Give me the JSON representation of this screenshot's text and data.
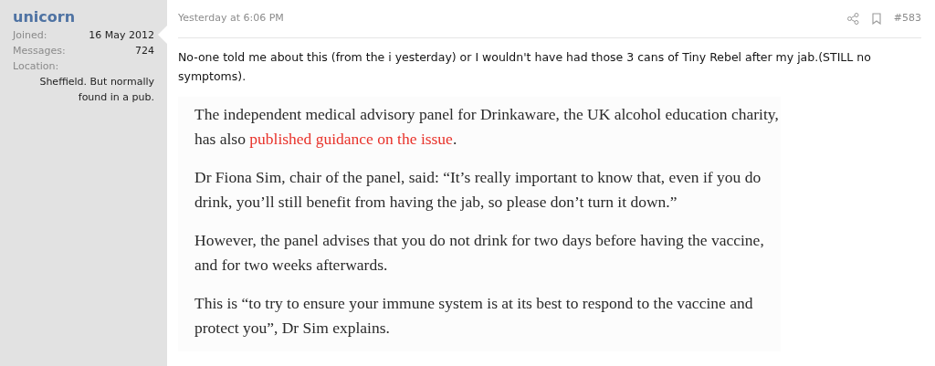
{
  "author": {
    "name": "unicorn",
    "stats": [
      {
        "label": "Joined:",
        "value": "16 May 2012"
      },
      {
        "label": "Messages:",
        "value": "724"
      }
    ],
    "location_label": "Location:",
    "location": "Sheffield. But normally found in a pub."
  },
  "post": {
    "time": "Yesterday at 6:06 PM",
    "number": "#583",
    "body": "No-one told me about this (from the i yesterday) or I wouldn't have had those 3 cans of Tiny Rebel after my jab.(STILL no symptoms).",
    "quote": [
      {
        "text": "The independent medical advisory panel for Drinkaware, the UK alcohol education charity, has also ",
        "link": "published guidance on the issue",
        "after": "."
      },
      {
        "text": "Dr Fiona Sim, chair of the panel, said: “It’s really important to know that, even if you do drink, you’ll still benefit from having the jab, so please don’t turn it down.”"
      },
      {
        "text": "However, the panel advises that you do not drink for two days before having the vaccine, and for two weeks afterwards."
      },
      {
        "text": "This is “to try to ensure your immune system is at its best to respond to the vaccine and protect you”, Dr Sim explains."
      }
    ]
  }
}
